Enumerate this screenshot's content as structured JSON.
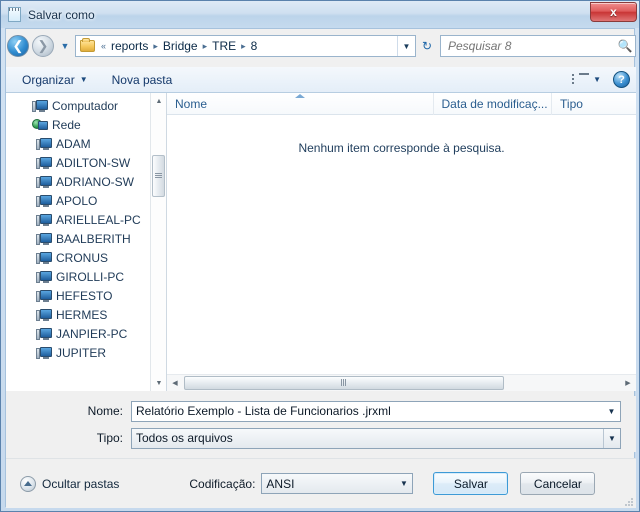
{
  "window": {
    "title": "Salvar como",
    "title_icon": "notepad-icon",
    "close_label": "x"
  },
  "nav": {
    "back_icon": "arrow-left-icon",
    "forward_icon": "arrow-right-icon",
    "history_dropdown_icon": "chevron-down-icon",
    "refresh_icon": "refresh-icon",
    "address_folder_icon": "folder-icon",
    "overflow": "«",
    "breadcrumbs": [
      "reports",
      "Bridge",
      "TRE",
      "8"
    ],
    "breadcrumb_separator": "▸",
    "address_dropdown_icon": "chevron-down-icon"
  },
  "search": {
    "placeholder": "Pesquisar 8",
    "value": "",
    "icon": "search-icon"
  },
  "toolbar": {
    "organize_label": "Organizar",
    "organize_caret_icon": "caret-down-icon",
    "new_folder_label": "Nova pasta",
    "view_icon": "view-list-icon",
    "view_caret_icon": "caret-down-icon",
    "help_icon": "help-icon",
    "help_label": "?"
  },
  "sidebar": {
    "items": [
      {
        "label": "Computador",
        "icon": "computer-icon",
        "level": 0
      },
      {
        "label": "Rede",
        "icon": "network-icon",
        "level": 0
      },
      {
        "label": "ADAM",
        "icon": "computer-icon",
        "level": 1
      },
      {
        "label": "ADILTON-SW",
        "icon": "computer-icon",
        "level": 1
      },
      {
        "label": "ADRIANO-SW",
        "icon": "computer-icon",
        "level": 1
      },
      {
        "label": "APOLO",
        "icon": "computer-icon",
        "level": 1
      },
      {
        "label": "ARIELLEAL-PC",
        "icon": "computer-icon",
        "level": 1
      },
      {
        "label": "BAALBERITH",
        "icon": "computer-icon",
        "level": 1
      },
      {
        "label": "CRONUS",
        "icon": "computer-icon",
        "level": 1
      },
      {
        "label": "GIROLLI-PC",
        "icon": "computer-icon",
        "level": 1
      },
      {
        "label": "HEFESTO",
        "icon": "computer-icon",
        "level": 1
      },
      {
        "label": "HERMES",
        "icon": "computer-icon",
        "level": 1
      },
      {
        "label": "JANPIER-PC",
        "icon": "computer-icon",
        "level": 1
      },
      {
        "label": "JUPITER",
        "icon": "computer-icon",
        "level": 1
      }
    ],
    "scroll_up_icon": "triangle-up-icon",
    "scroll_down_icon": "triangle-down-icon"
  },
  "filelist": {
    "columns": [
      {
        "label": "Nome",
        "sorted": "asc"
      },
      {
        "label": "Data de modificaç...",
        "sorted": ""
      },
      {
        "label": "Tipo",
        "sorted": ""
      }
    ],
    "empty_message": "Nenhum item corresponde à pesquisa.",
    "rows": [],
    "hscroll_left_icon": "triangle-left-icon",
    "hscroll_right_icon": "triangle-right-icon"
  },
  "form": {
    "name_label": "Nome:",
    "name_value": "Relatório Exemplo - Lista de Funcionarios .jrxml",
    "name_dropdown_icon": "caret-down-icon",
    "type_label": "Tipo:",
    "type_value": "Todos os arquivos",
    "type_dropdown_icon": "caret-down-icon"
  },
  "footer": {
    "hide_folders_label": "Ocultar pastas",
    "hide_folders_icon": "chevron-up-circle-icon",
    "encoding_label": "Codificação:",
    "encoding_value": "ANSI",
    "encoding_dropdown_icon": "caret-down-icon",
    "save_label": "Salvar",
    "cancel_label": "Cancelar",
    "resize_grip_icon": "resize-grip-icon"
  },
  "colors": {
    "titlebar": "#c5daee",
    "accent": "#2f8cd0",
    "close_red": "#c93535",
    "focus_blue": "#3d9ad6",
    "folder_yellow": "#f5c85c",
    "link_text": "#15396b"
  }
}
